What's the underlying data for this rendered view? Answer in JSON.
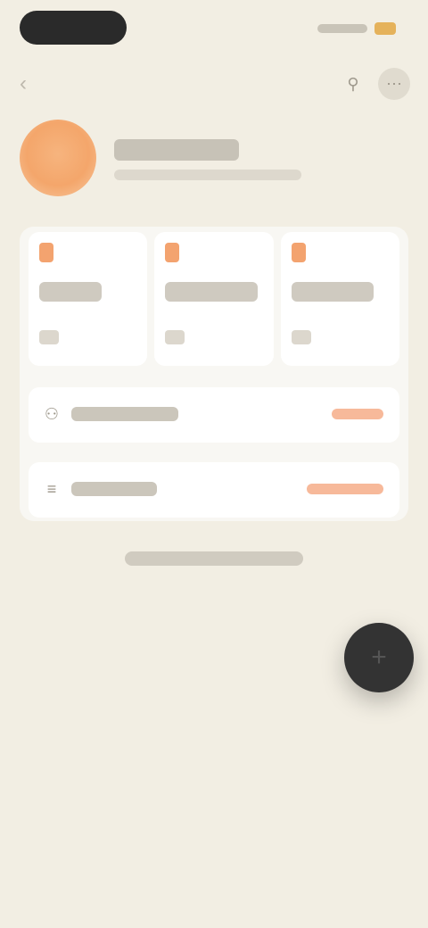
{
  "status_bar": {
    "time": "",
    "icons": [
      "signal-icon",
      "battery-icon"
    ],
    "battery_color": "#e5b25b"
  },
  "nav": {
    "back_icon": "chevron-left-icon",
    "title": "",
    "action_icons": [
      "filter-icon",
      "more-icon"
    ]
  },
  "profile": {
    "avatar_color": "#f4a66b",
    "avatar_initials": "",
    "name": "",
    "subtitle": ""
  },
  "tiles": [
    {
      "label": "",
      "value": ""
    },
    {
      "label": "",
      "value": ""
    },
    {
      "label": "",
      "value": ""
    }
  ],
  "rows": [
    {
      "icon": "user-icon",
      "label": "",
      "action": ""
    },
    {
      "icon": "list-icon",
      "label": "",
      "action": ""
    }
  ],
  "footer": {
    "link_text": ""
  },
  "fab": {
    "icon": "plus-icon"
  },
  "colors": {
    "background": "#f2eee3",
    "accent": "#f3a36f",
    "fab": "#333333"
  }
}
